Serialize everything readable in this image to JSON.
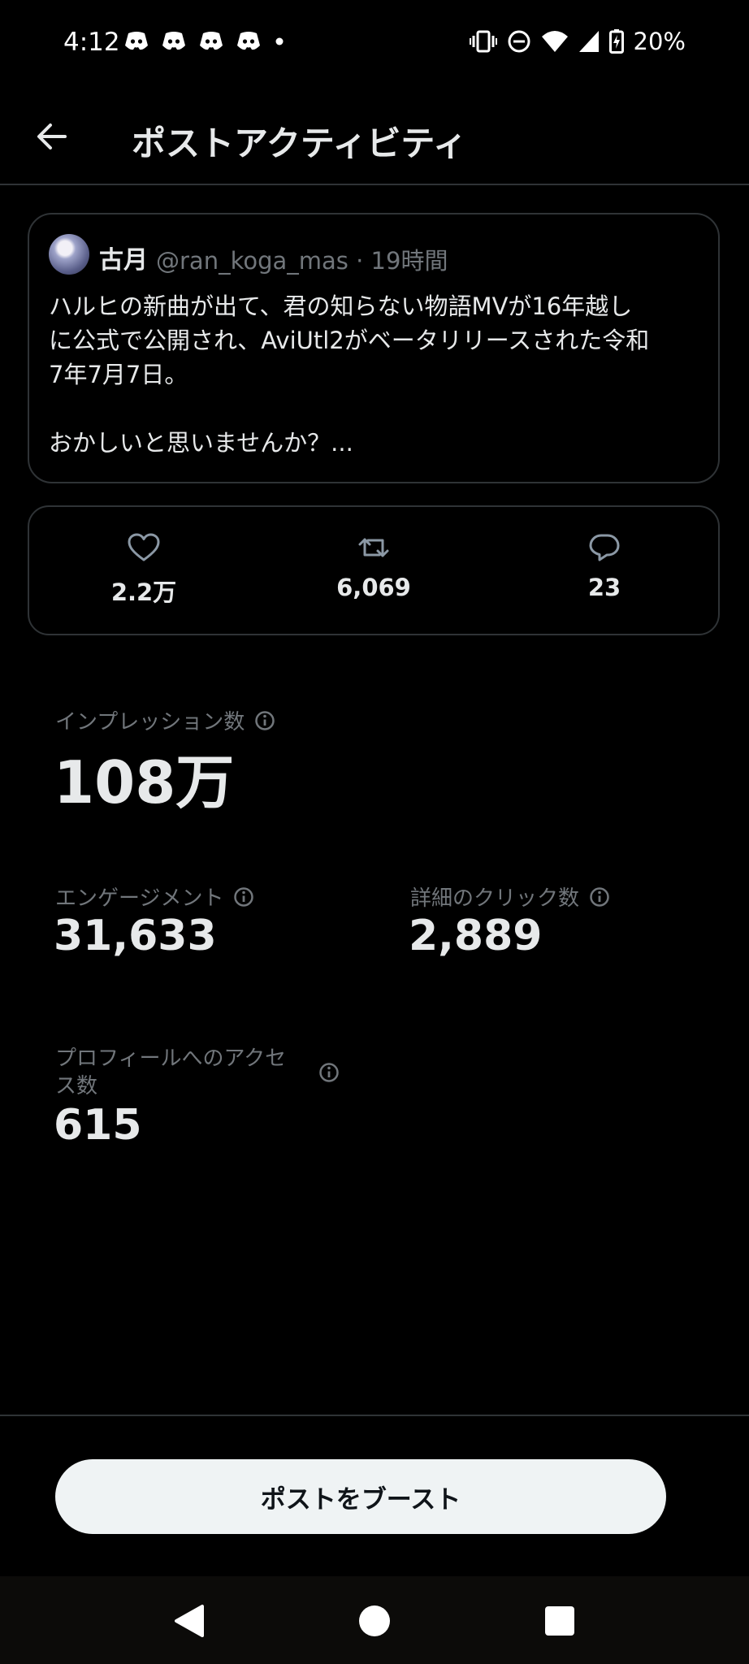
{
  "status_bar": {
    "time": "4:12",
    "battery": "20%",
    "left_icons": [
      "discord-icon",
      "discord-icon",
      "discord-icon",
      "discord-icon",
      "dot-icon"
    ],
    "right_icons": [
      "vibrate-icon",
      "dnd-icon",
      "wifi-icon",
      "signal-icon",
      "battery-charging-icon"
    ]
  },
  "header": {
    "title": "ポストアクティビティ",
    "back_icon": "arrow-left-icon"
  },
  "post": {
    "author_name": "古月",
    "author_meta": "@ran_koga_mas · 19時間",
    "text": "ハルヒの新曲が出て、君の知らない物語MVが16年越し\nに公式で公開され、AviUtl2がベータリリースされた令和\n7年7月7日。\n\nおかしいと思いませんか？..."
  },
  "engagement": {
    "likes": "2.2万",
    "reposts": "6,069",
    "replies": "23"
  },
  "metrics": {
    "impressions_label": "インプレッション数",
    "impressions_value": "108万",
    "engagement_label": "エンゲージメント",
    "engagement_value": "31,633",
    "detail_clicks_label": "詳細のクリック数",
    "detail_clicks_value": "2,889",
    "profile_visits_label": "プロフィールへのアクセ\nス数",
    "profile_visits_value": "615"
  },
  "boost": {
    "label": "ポストをブースト"
  },
  "colors": {
    "background": "#000000",
    "text": "#e7e9ea",
    "muted": "#71767b",
    "border": "#2f3336",
    "button_bg": "#eff3f4"
  }
}
